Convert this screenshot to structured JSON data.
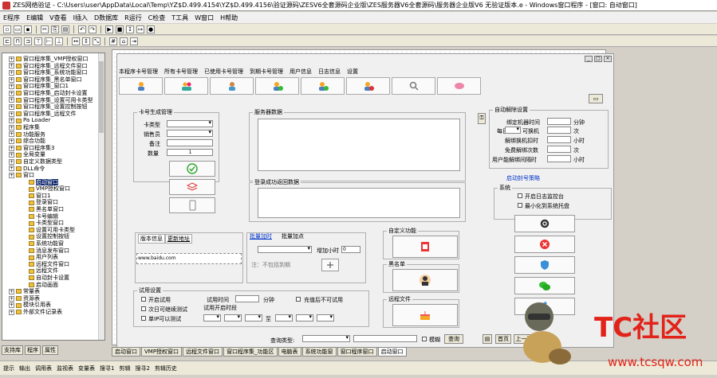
{
  "title": "ZES网络验证 - C:\\Users\\user\\AppData\\Local\\Temp\\YZ$D.499.4154\\YZ$D.499.4156\\验证源码\\ZESV6全套源码企业版\\ZES服务器V6全套源码\\服务器企业版V6 无验证版本.e - Windows窗口程序 - [窗口: 自动窗口]",
  "menu": [
    "E程序",
    "E编辑",
    "V查看",
    "I插入",
    "D数据库",
    "R运行",
    "C检查",
    "T工具",
    "W窗口",
    "H帮助"
  ],
  "tree": {
    "items": [
      {
        "label": "窗口程序集_VMP授权窗口",
        "sel": false
      },
      {
        "label": "窗口程序集_远程文件窗口",
        "sel": false
      },
      {
        "label": "窗口程序集_系统功能窗口",
        "sel": false
      },
      {
        "label": "窗口程序集_黑名单窗口",
        "sel": false
      },
      {
        "label": "窗口程序集_窗口1",
        "sel": false
      },
      {
        "label": "窗口程序集_启动封卡设置",
        "sel": false
      },
      {
        "label": "窗口程序集_设置可用卡类型",
        "sel": false
      },
      {
        "label": "窗口程序集_设置控制按钮",
        "sel": false
      },
      {
        "label": "窗口程序集_远程文件",
        "sel": false
      },
      {
        "label": "Pa Loader",
        "sel": false
      },
      {
        "label": "程序集",
        "sel": false
      },
      {
        "label": "功能服务",
        "sel": false
      },
      {
        "label": "综合功能",
        "sel": false
      },
      {
        "label": "窗口程序集3",
        "sel": false
      },
      {
        "label": "全局变量",
        "sel": false
      },
      {
        "label": "自定义数据类型",
        "sel": false
      },
      {
        "label": "DLL命令",
        "sel": false
      },
      {
        "label": "窗口",
        "sel": false
      },
      {
        "label": "启动窗口",
        "sel": true
      },
      {
        "label": "VMP授权窗口",
        "sel": false
      },
      {
        "label": "窗口1",
        "sel": false
      },
      {
        "label": "登录窗口",
        "sel": false
      },
      {
        "label": "黑名单窗口",
        "sel": false
      },
      {
        "label": "卡号编辑",
        "sel": false
      },
      {
        "label": "卡类型窗口",
        "sel": false
      },
      {
        "label": "设置可用卡类型",
        "sel": false
      },
      {
        "label": "设置控制按钮",
        "sel": false
      },
      {
        "label": "系统功能窗",
        "sel": false
      },
      {
        "label": "消息发布窗口",
        "sel": false
      },
      {
        "label": "用户列表",
        "sel": false
      },
      {
        "label": "远程文件窗口",
        "sel": false
      },
      {
        "label": "远程文件",
        "sel": false
      },
      {
        "label": "自动封卡设置",
        "sel": false
      },
      {
        "label": "启动画面",
        "sel": false
      },
      {
        "label": "常量表",
        "sel": false
      },
      {
        "label": "资源表",
        "sel": false
      },
      {
        "label": "模块引用表",
        "sel": false
      },
      {
        "label": "外部文件记录表",
        "sel": false
      }
    ]
  },
  "lefttabs": [
    "支持库",
    "程序",
    "属性"
  ],
  "bottomtabs": [
    "启动窗口",
    "VMP授权窗口",
    "远程文件窗口",
    "窗口程序集_功能区",
    "电脑表",
    "系统功能窗",
    "窗口程序窗口",
    "启动窗口"
  ],
  "statusbar": [
    "提示",
    "输出",
    "调用表",
    "监视表",
    "变量表",
    "搜寻1",
    "剪辑",
    "搜寻2",
    "剪辑历史"
  ],
  "form": {
    "tabs": [
      "本程序卡号管理",
      "所有卡号管理",
      "已使用卡号管理",
      "到期卡号管理",
      "用户信息",
      "日志信息",
      "设置"
    ],
    "grp_card": "卡号生成管理",
    "lbl_cardtype": "卡类型",
    "lbl_agent": "销售员",
    "lbl_note": "备注",
    "lbl_qty": "数量",
    "qty_value": "1",
    "grp_server": "服务器数据",
    "grp_announce": "登录成功返回数据",
    "tab_official": "版本信息",
    "tab_update": "更新地址",
    "url_value": "www.baidu.com",
    "tab_batch_add": "批量加时",
    "tab_batch_pts": "批量加点",
    "lbl_addtime": "增加小时",
    "addtime_value": "0",
    "lbl_batch_note": "注：不包括到期",
    "grp_custom": "自定义功能",
    "grp_blacklist": "黑名单",
    "grp_remote": "远程文件",
    "grp_auto": "自动解除设置",
    "lbl_bind_time": "绑定机器时间",
    "unit_min": "分钟",
    "lbl_every": "每日",
    "lbl_times": "可换机",
    "unit_times": "次",
    "lbl_unbind": "解绑换机扣时",
    "unit_hour": "小时",
    "lbl_free": "免费解绑次数",
    "unit_times2": "次",
    "lbl_user_unbind": "用户能解绑间隔时",
    "unit_hour2": "小时",
    "link_auto": "启动封号策略",
    "grp_system": "系统",
    "chk_log": "开启日志监控台",
    "chk_min": "最小化到系统托盘",
    "grp_test": "试用设置",
    "chk_open": "开启试用",
    "chk_once": "次日可继续测试",
    "chk_single": "单IP可以测试",
    "lbl_testtime": "试用时间",
    "unit_min2": "分钟",
    "chk_tray": "充值后不可试用",
    "lbl_period": "试用开启时段",
    "lbl_to": "至",
    "lbl_query": "查询类型:",
    "chk_fuzzy": "模糊",
    "btn_query": "查询",
    "btn_first": "首页",
    "btn_prev": "上一页"
  },
  "watermark": {
    "brand": "TC社区",
    "url": "www.tcsqw.com"
  }
}
